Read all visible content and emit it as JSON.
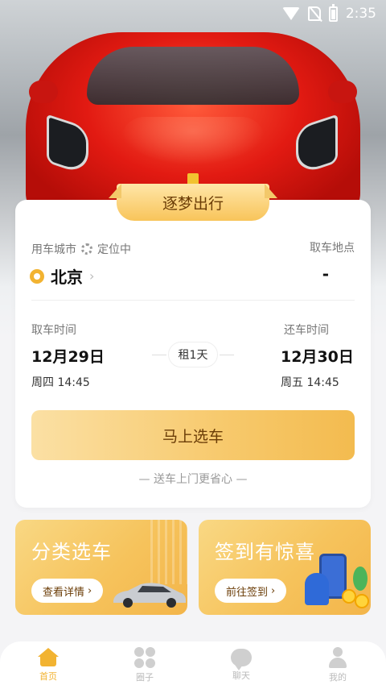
{
  "status_bar": {
    "time": "2:35"
  },
  "hero": {
    "image": "red-sports-car-front-view"
  },
  "card": {
    "tab_title": "逐梦出行",
    "city_label": "用车城市",
    "locate_text": "定位中",
    "city_value": "北京",
    "pickup_label": "取车地点",
    "pickup_value": "-",
    "start_label": "取车时间",
    "start_date": "12月29日",
    "start_time": "周四 14:45",
    "end_label": "还车时间",
    "end_date": "12月30日",
    "end_time": "周五 14:45",
    "rent_days": "租1天",
    "select_button": "马上选车",
    "slogan": "— 送车上门更省心 —"
  },
  "promos": [
    {
      "title": "分类选车",
      "button": "查看详情"
    },
    {
      "title": "签到有惊喜",
      "button": "前往签到"
    }
  ],
  "nav": {
    "items": [
      {
        "label": "首页",
        "icon": "home-icon",
        "active": true
      },
      {
        "label": "圈子",
        "icon": "circle-icon",
        "active": false
      },
      {
        "label": "聊天",
        "icon": "chat-icon",
        "active": false
      },
      {
        "label": "我的",
        "icon": "user-icon",
        "active": false
      }
    ]
  },
  "colors": {
    "accent": "#f2b331",
    "button_gradient_start": "#fbe0a4",
    "button_gradient_end": "#f3bb4f",
    "button_text": "#6b3d07"
  }
}
